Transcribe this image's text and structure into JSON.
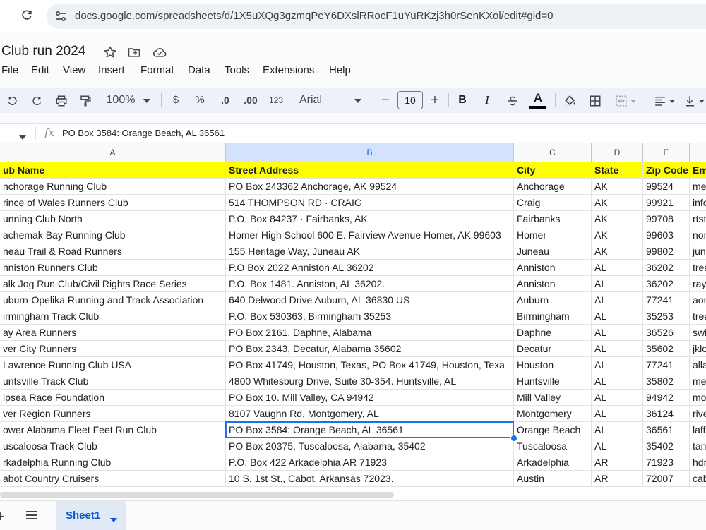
{
  "browser": {
    "url": "docs.google.com/spreadsheets/d/1X5uXQg3gzmqPeY6DXslRRocF1uYuRKzj3h0rSenKXol/edit#gid=0"
  },
  "doc": {
    "title": "Club run 2024"
  },
  "menu": [
    "File",
    "Edit",
    "View",
    "Insert",
    "Format",
    "Data",
    "Tools",
    "Extensions",
    "Help"
  ],
  "toolbar": {
    "zoom": "100%",
    "currency": "$",
    "percent": "%",
    "dec_decrease": ".0",
    "dec_increase": ".00",
    "number_format": "123",
    "font": "Arial",
    "font_size": "10",
    "bold": "B",
    "italic": "I",
    "text_color": "A"
  },
  "formula_bar": {
    "fx": "fx",
    "content": "PO Box 3584: Orange Beach, AL 36561"
  },
  "columns": [
    "A",
    "B",
    "C",
    "D",
    "E"
  ],
  "rows": [
    [
      "ub Name",
      "Street Address",
      "City",
      "State",
      "Zip Code",
      "Em"
    ],
    [
      "nchorage Running Club",
      "PO Box 243362 Anchorage, AK 99524",
      "Anchorage",
      "AK",
      "99524",
      "me"
    ],
    [
      "rince of Wales Runners Club",
      "514 THOMPSON RD · CRAIG",
      "Craig",
      "AK",
      "99921",
      "info"
    ],
    [
      "unning Club North",
      "P.O. Box 84237 · Fairbanks, AK",
      "Fairbanks",
      "AK",
      "99708",
      "rtst"
    ],
    [
      "achemak Bay Running Club",
      "Homer High School 600 E. Fairview Avenue Homer, AK 99603",
      "Homer",
      "AK",
      "99603",
      "nor"
    ],
    [
      "neau Trail & Road Runners",
      "155 Heritage Way, Juneau AK",
      "Juneau",
      "AK",
      "99802",
      "jun"
    ],
    [
      "nniston Runners Club",
      "P.O Box 2022 Anniston AL 36202",
      "Anniston",
      "AL",
      "36202",
      "trea"
    ],
    [
      "alk Jog Run Club/Civil Rights Race Series",
      "P.O. Box 1481. Anniston, AL 36202.",
      "Anniston",
      "AL",
      "36202",
      "ray"
    ],
    [
      "uburn-Opelika Running and Track Association",
      "640 Delwood Drive Auburn, AL 36830 US",
      "Auburn",
      "AL",
      "77241",
      "aor"
    ],
    [
      "irmingham Track Club",
      "P.O. Box 530363, Birmingham 35253",
      "Birmingham",
      "AL",
      "35253",
      "trea"
    ],
    [
      "ay Area Runners",
      "PO Box 2161, Daphne, Alabama",
      "Daphne",
      "AL",
      "36526",
      "swi"
    ],
    [
      "ver City Runners",
      "PO Box 2343, Decatur, Alabama 35602",
      "Decatur",
      "AL",
      "35602",
      "jklo"
    ],
    [
      " Lawrence Running Club USA",
      "PO Box 41749, Houston, Texas, PO Box 41749, Houston, Texa",
      "Houston",
      "AL",
      "77241",
      "alla"
    ],
    [
      "untsville Track Club",
      "4800 Whitesburg Drive, Suite 30-354. Huntsville, AL",
      "Huntsville",
      "AL",
      "35802",
      "me"
    ],
    [
      "ipsea Race Foundation",
      "PO Box 10. Mill Valley, CA 94942",
      "Mill Valley",
      "AL",
      "94942",
      "mo"
    ],
    [
      "ver Region Runners",
      "8107 Vaughn Rd, Montgomery, AL",
      "Montgomery",
      "AL",
      "36124",
      "rive"
    ],
    [
      "ower Alabama Fleet Feet Run Club",
      "PO Box 3584: Orange Beach, AL 36561",
      "Orange Beach",
      "AL",
      "36561",
      "laff"
    ],
    [
      "uscaloosa Track Club",
      "PO Box 20375, Tuscaloosa, Alabama, 35402",
      "Tuscaloosa",
      "AL",
      "35402",
      "tan"
    ],
    [
      "rkadelphia Running Club",
      "P.O. Box 422 Arkadelphia AR 71923",
      "Arkadelphia",
      "AR",
      "71923",
      "hdr"
    ],
    [
      "abot Country Cruisers",
      "10 S. 1st St., Cabot, Arkansas 72023.",
      "Austin",
      "AR",
      "72007",
      "cab"
    ]
  ],
  "sheets": [
    {
      "label": "Sheet1"
    }
  ]
}
